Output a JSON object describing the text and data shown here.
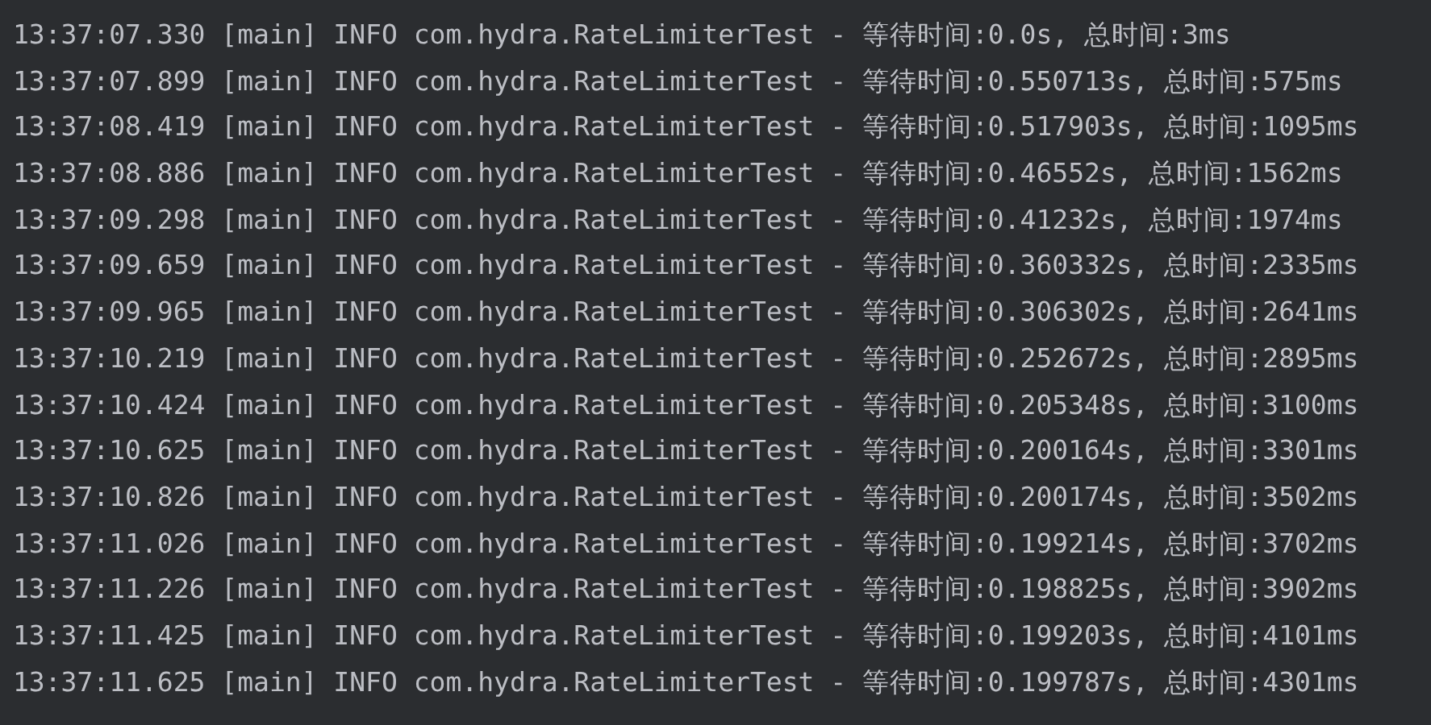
{
  "console": {
    "lines": [
      {
        "text": "13:37:07.330 [main] INFO com.hydra.RateLimiterTest - 等待时间:0.0s, 总时间:3ms"
      },
      {
        "text": "13:37:07.899 [main] INFO com.hydra.RateLimiterTest - 等待时间:0.550713s, 总时间:575ms"
      },
      {
        "text": "13:37:08.419 [main] INFO com.hydra.RateLimiterTest - 等待时间:0.517903s, 总时间:1095ms"
      },
      {
        "text": "13:37:08.886 [main] INFO com.hydra.RateLimiterTest - 等待时间:0.46552s, 总时间:1562ms"
      },
      {
        "text": "13:37:09.298 [main] INFO com.hydra.RateLimiterTest - 等待时间:0.41232s, 总时间:1974ms"
      },
      {
        "text": "13:37:09.659 [main] INFO com.hydra.RateLimiterTest - 等待时间:0.360332s, 总时间:2335ms"
      },
      {
        "text": "13:37:09.965 [main] INFO com.hydra.RateLimiterTest - 等待时间:0.306302s, 总时间:2641ms"
      },
      {
        "text": "13:37:10.219 [main] INFO com.hydra.RateLimiterTest - 等待时间:0.252672s, 总时间:2895ms"
      },
      {
        "text": "13:37:10.424 [main] INFO com.hydra.RateLimiterTest - 等待时间:0.205348s, 总时间:3100ms"
      },
      {
        "text": "13:37:10.625 [main] INFO com.hydra.RateLimiterTest - 等待时间:0.200164s, 总时间:3301ms"
      },
      {
        "text": "13:37:10.826 [main] INFO com.hydra.RateLimiterTest - 等待时间:0.200174s, 总时间:3502ms"
      },
      {
        "text": "13:37:11.026 [main] INFO com.hydra.RateLimiterTest - 等待时间:0.199214s, 总时间:3702ms"
      },
      {
        "text": "13:37:11.226 [main] INFO com.hydra.RateLimiterTest - 等待时间:0.198825s, 总时间:3902ms"
      },
      {
        "text": "13:37:11.425 [main] INFO com.hydra.RateLimiterTest - 等待时间:0.199203s, 总时间:4101ms"
      },
      {
        "text": "13:37:11.625 [main] INFO com.hydra.RateLimiterTest - 等待时间:0.199787s, 总时间:4301ms"
      }
    ]
  }
}
